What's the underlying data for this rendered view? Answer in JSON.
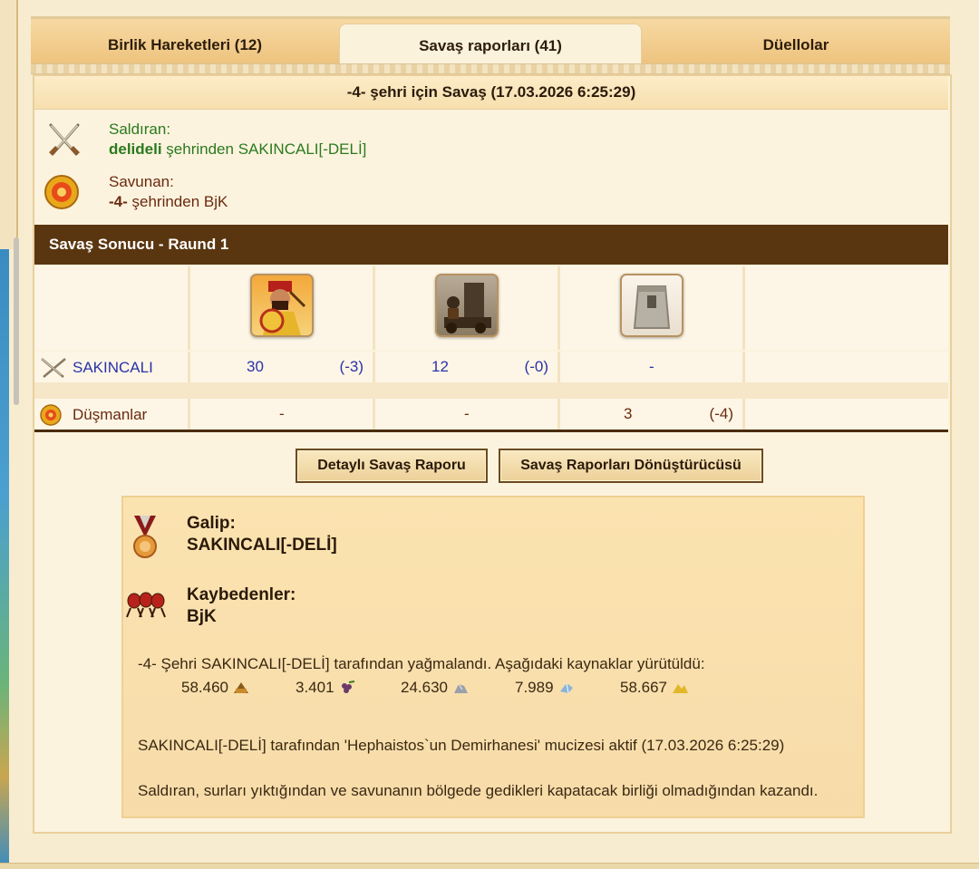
{
  "tabs": [
    {
      "label": "Birlik Hareketleri (12)"
    },
    {
      "label": "Savaş raporları (41)"
    },
    {
      "label": "Düellolar"
    }
  ],
  "battle": {
    "title": "-4- şehri için Savaş (17.03.2026 6:25:29)",
    "attacker_label": "Saldıran:",
    "attacker_city": "delideli",
    "attacker_rest": " şehrinden SAKINCALI[-DELİ]",
    "defender_label": "Savunan:",
    "defender_city": "-4-",
    "defender_rest": " şehrinden BjK"
  },
  "round": {
    "title": "Savaş Sonucu - Raund 1"
  },
  "table": {
    "units": [
      "hoplite-unit-icon",
      "catapult-unit-icon",
      "city-wall-icon"
    ],
    "rows": [
      {
        "label": "SAKINCALI",
        "cells": [
          {
            "value": "30",
            "loss": "(-3)"
          },
          {
            "value": "12",
            "loss": "(-0)"
          },
          {
            "value": "-",
            "loss": ""
          }
        ]
      },
      {
        "label": "Düşmanlar",
        "cells": [
          {
            "value": "-",
            "loss": ""
          },
          {
            "value": "-",
            "loss": ""
          },
          {
            "value": "3",
            "loss": "(-4)"
          }
        ]
      }
    ]
  },
  "buttons": {
    "detailed": "Detaylı Savaş Raporu",
    "converter": "Savaş Raporları Dönüştürücüsü"
  },
  "result": {
    "winner_label": "Galip:",
    "winner_name": "SAKINCALI[-DELİ]",
    "losers_label": "Kaybedenler:",
    "losers_name": "BjK",
    "plunder_text": "-4- Şehri SAKINCALI[-DELİ] tarafından yağmalandı. Aşağıdaki kaynaklar yürütüldü:",
    "resources": [
      {
        "amount": "58.460",
        "icon": "wood-icon"
      },
      {
        "amount": "3.401",
        "icon": "grapes-icon"
      },
      {
        "amount": "24.630",
        "icon": "marble-icon"
      },
      {
        "amount": "7.989",
        "icon": "crystal-icon"
      },
      {
        "amount": "58.667",
        "icon": "sulfur-icon"
      }
    ],
    "wonder_text": "SAKINCALI[-DELİ] tarafından 'Hephaistos`un Demirhanesi' mucizesi aktif (17.03.2026 6:25:29)",
    "reason_text": "Saldıran, surları yıktığından ve savunanın bölgede gedikleri kapatacak birliği olmadığından kazandı."
  },
  "colors": {
    "attacker": "#2a7a1e",
    "defender": "#6a2a10",
    "own_units": "#2b32a8",
    "round_bar": "#5a3610"
  }
}
